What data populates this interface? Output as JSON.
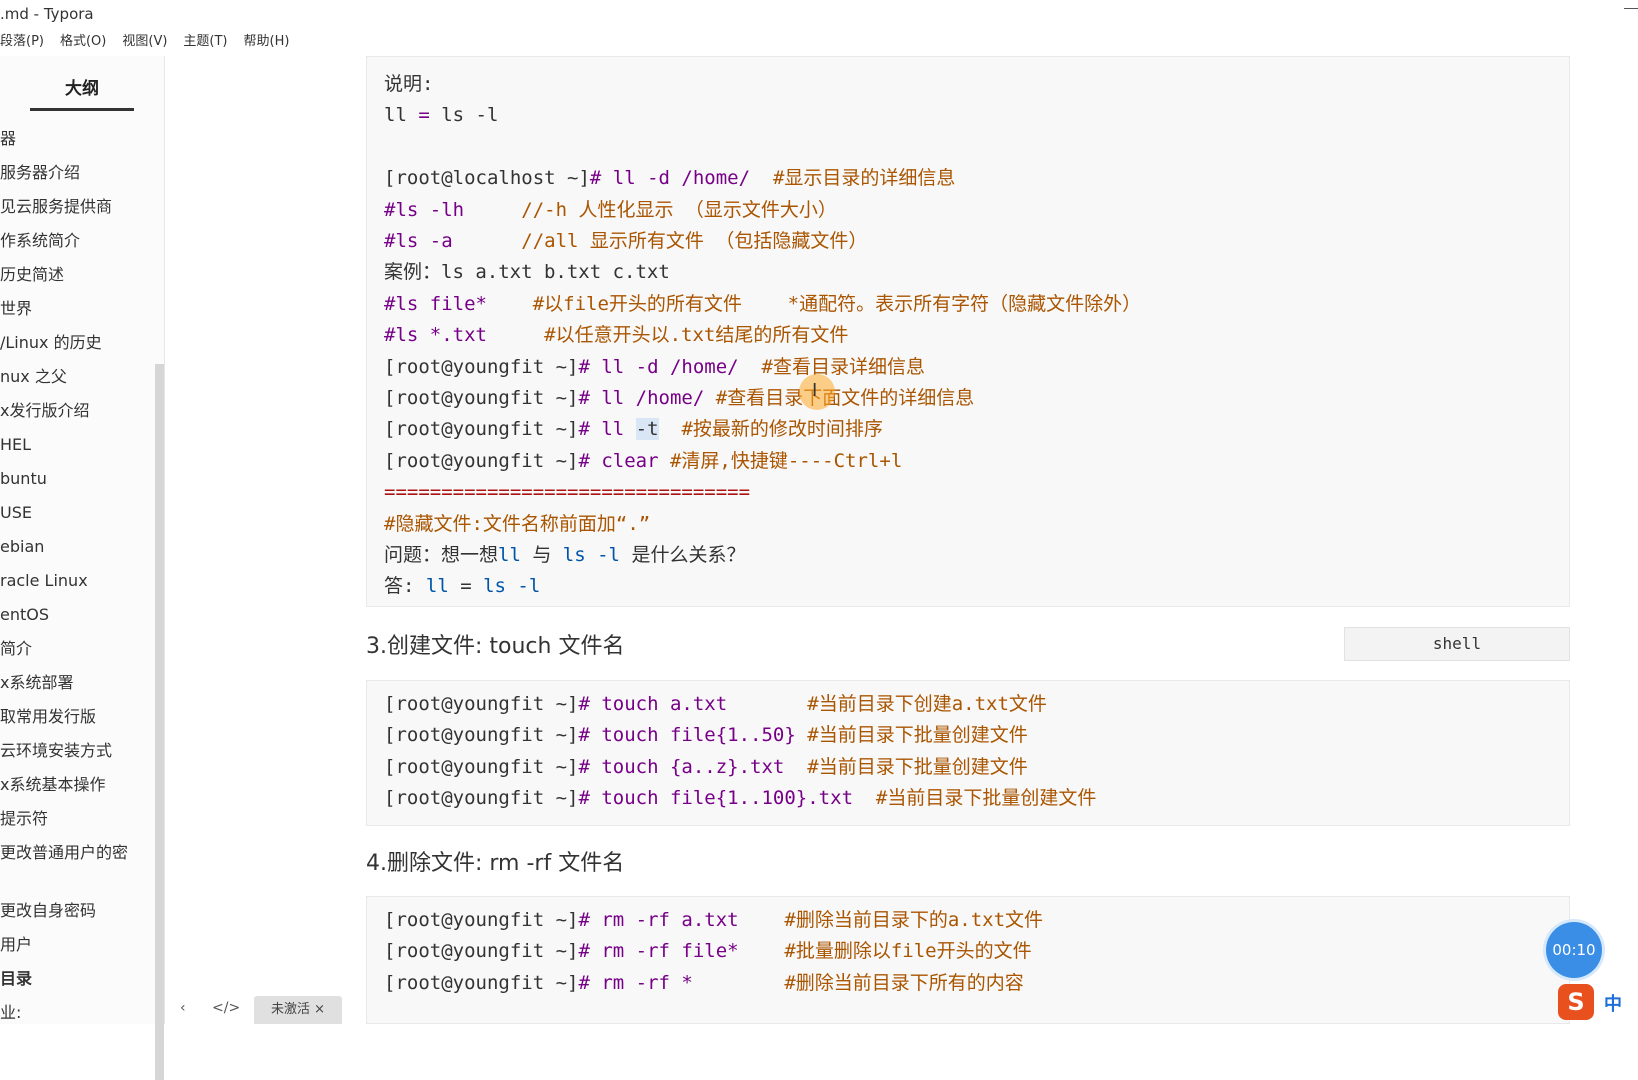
{
  "window": {
    "title": ".md - Typora"
  },
  "menu": [
    "段落(P)",
    "格式(O)",
    "视图(V)",
    "主题(T)",
    "帮助(H)"
  ],
  "sidebar": {
    "tab": "大纲",
    "items": [
      {
        "label": "器"
      },
      {
        "label": "服务器介绍"
      },
      {
        "label": "见云服务提供商"
      },
      {
        "label": "作系统简介"
      },
      {
        "label": "历史简述"
      },
      {
        "label": "世界"
      },
      {
        "label": "/Linux 的历史"
      },
      {
        "label": "nux 之父"
      },
      {
        "label": "x发行版介绍"
      },
      {
        "label": "HEL"
      },
      {
        "label": "buntu"
      },
      {
        "label": "USE"
      },
      {
        "label": "ebian"
      },
      {
        "label": "racle Linux"
      },
      {
        "label": "entOS"
      },
      {
        "label": "简介"
      },
      {
        "label": "x系统部署"
      },
      {
        "label": "取常用发行版"
      },
      {
        "label": "云环境安装方式"
      },
      {
        "label": "x系统基本操作"
      },
      {
        "label": "提示符"
      },
      {
        "label": "更改普通用户的密"
      },
      {
        "label": "更改自身密码"
      },
      {
        "label": "用户"
      },
      {
        "label": "目录"
      },
      {
        "label": "业:"
      }
    ]
  },
  "bottombar": {
    "prev": "‹",
    "source": "</>",
    "status": "未激活 ×"
  },
  "block1": [
    [
      [
        "pl",
        "说明:"
      ]
    ],
    [
      [
        "pl",
        "ll "
      ],
      [
        "kw",
        "="
      ],
      [
        "pl",
        " ls -l"
      ]
    ],
    [
      [
        "pl",
        ""
      ]
    ],
    [
      [
        "pl",
        "[root@localhost ~]"
      ],
      [
        "kw",
        "# ll -d /home/"
      ],
      [
        "cm",
        "  #显示目录的详细信息"
      ]
    ],
    [
      [
        "kw",
        "#ls -lh"
      ],
      [
        "cm",
        "     //-h 人性化显示 （显示文件大小）"
      ]
    ],
    [
      [
        "kw",
        "#ls -a"
      ],
      [
        "cm",
        "      //all 显示所有文件 （包括隐藏文件）"
      ]
    ],
    [
      [
        "pl",
        "案例：ls a.txt b.txt c.txt"
      ]
    ],
    [
      [
        "kw",
        "#ls file*"
      ],
      [
        "cm",
        "    #以file开头的所有文件    *通配符。表示所有字符（隐藏文件除外）"
      ]
    ],
    [
      [
        "kw",
        "#ls *.txt"
      ],
      [
        "cm",
        "     #以任意开头以.txt结尾的所有文件"
      ]
    ],
    [
      [
        "pl",
        "[root@youngfit ~]"
      ],
      [
        "kw",
        "# ll -d /home/"
      ],
      [
        "cm",
        "  #查看目录详细信息"
      ]
    ],
    [
      [
        "pl",
        "[root@youngfit ~]"
      ],
      [
        "kw",
        "# ll /home/ "
      ],
      [
        "cm",
        "#查看目录下面文件的详细信息"
      ]
    ],
    [
      [
        "pl",
        "[root@youngfit ~]"
      ],
      [
        "kw",
        "# ll "
      ],
      [
        "sel",
        "-t"
      ],
      [
        "cm",
        "  #按最新的修改时间排序"
      ]
    ],
    [
      [
        "pl",
        "[root@youngfit ~]"
      ],
      [
        "kw",
        "# clear "
      ],
      [
        "cm",
        "#清屏,快捷键----Ctrl+l"
      ]
    ],
    [
      [
        "sep",
        "================================"
      ]
    ],
    [
      [
        "cm",
        "#隐藏文件:文件名称前面加“.”"
      ]
    ],
    [
      [
        "pl",
        "问题：想一想"
      ],
      [
        "var",
        "ll"
      ],
      [
        "pl",
        " 与 "
      ],
      [
        "var",
        "ls -l"
      ],
      [
        "pl",
        " 是什么关系？"
      ]
    ],
    [
      [
        "pl",
        "答: "
      ],
      [
        "var",
        "ll"
      ],
      [
        "pl",
        " = "
      ],
      [
        "var",
        "ls -l"
      ]
    ]
  ],
  "lang_label": "shell",
  "heading3": "3.创建文件: touch 文件名",
  "block2": [
    [
      [
        "pl",
        "[root@youngfit ~]"
      ],
      [
        "kw",
        "# touch a.txt"
      ],
      [
        "cm",
        "       #当前目录下创建a.txt文件"
      ]
    ],
    [
      [
        "pl",
        "[root@youngfit ~]"
      ],
      [
        "kw",
        "# touch file{1..50} "
      ],
      [
        "cm",
        "#当前目录下批量创建文件"
      ]
    ],
    [
      [
        "pl",
        "[root@youngfit ~]"
      ],
      [
        "kw",
        "# touch {a..z}.txt "
      ],
      [
        "cm",
        " #当前目录下批量创建文件"
      ]
    ],
    [
      [
        "pl",
        "[root@youngfit ~]"
      ],
      [
        "kw",
        "# touch file{1..100}.txt "
      ],
      [
        "cm",
        " #当前目录下批量创建文件"
      ]
    ]
  ],
  "heading4": "4.删除文件:   rm -rf  文件名",
  "block3": [
    [
      [
        "pl",
        "[root@youngfit ~]"
      ],
      [
        "kw",
        "# rm -rf a.txt"
      ],
      [
        "cm",
        "    #删除当前目录下的a.txt文件"
      ]
    ],
    [
      [
        "pl",
        "[root@youngfit ~]"
      ],
      [
        "kw",
        "# rm -rf file*"
      ],
      [
        "cm",
        "    #批量删除以file开头的文件"
      ]
    ],
    [
      [
        "pl",
        "[root@youngfit ~]"
      ],
      [
        "kw",
        "# rm -rf *"
      ],
      [
        "cm",
        "        #删除当前目录下所有的内容"
      ]
    ]
  ],
  "timer": "00:10",
  "ime": {
    "logo": "S",
    "mode": "中"
  }
}
